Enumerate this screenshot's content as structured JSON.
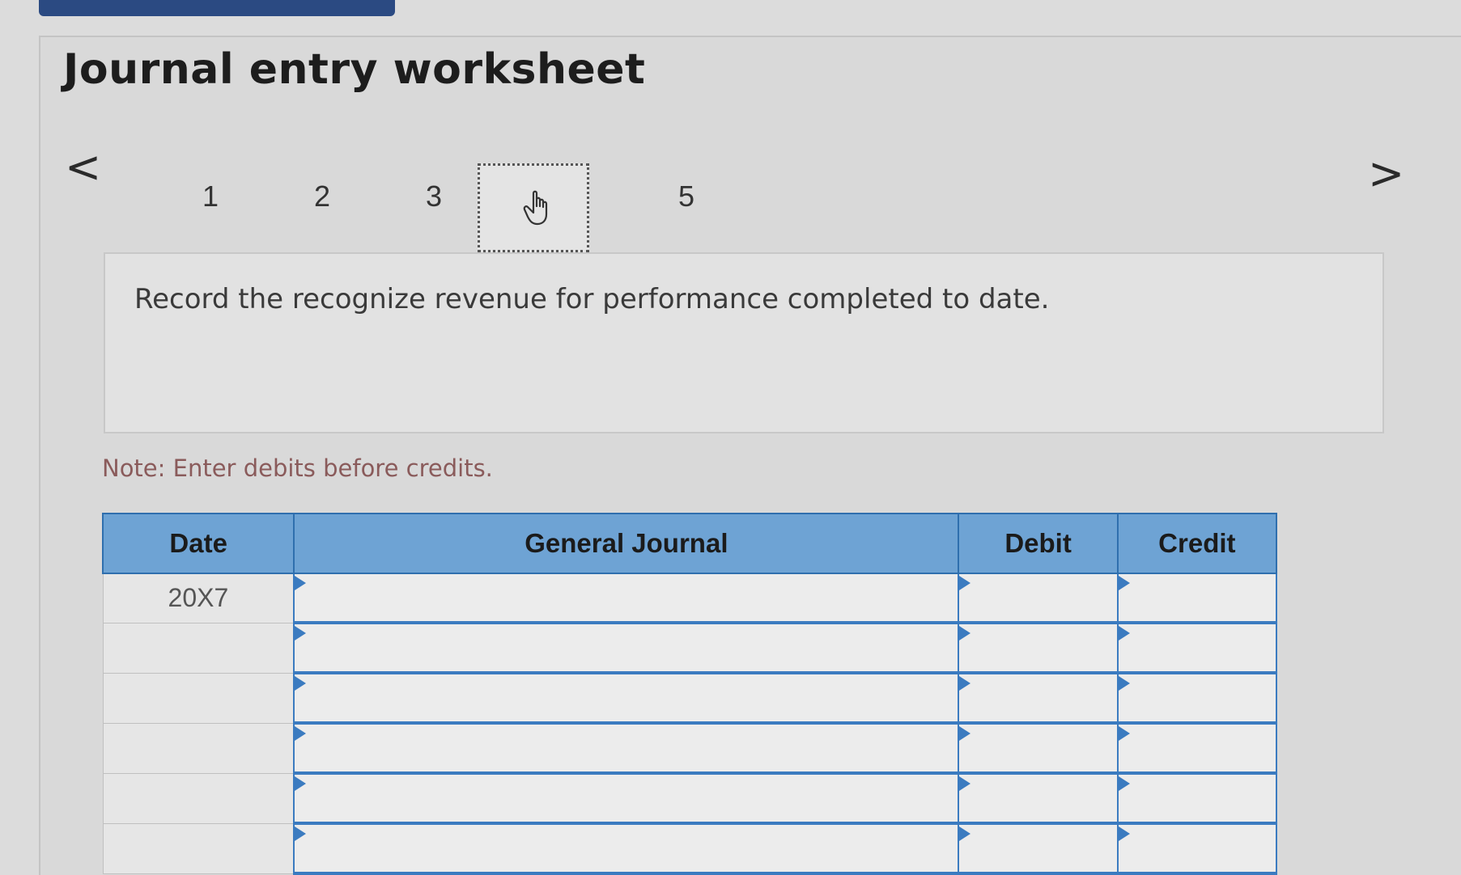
{
  "worksheet": {
    "title": "Journal entry worksheet"
  },
  "pager": {
    "prev_label": "<",
    "next_label": ">",
    "pages": [
      {
        "label": "1"
      },
      {
        "label": "2"
      },
      {
        "label": "3"
      },
      {
        "label": "",
        "current": true,
        "icon": "hand-pointer-icon"
      },
      {
        "label": "5"
      }
    ]
  },
  "instruction": {
    "text": "Record the recognize revenue for performance completed to date."
  },
  "note": {
    "text": "Note: Enter debits before credits."
  },
  "table": {
    "headers": {
      "date": "Date",
      "general_journal": "General Journal",
      "debit": "Debit",
      "credit": "Credit"
    },
    "rows": [
      {
        "date": "20X7"
      },
      {
        "date": ""
      },
      {
        "date": ""
      },
      {
        "date": ""
      },
      {
        "date": ""
      },
      {
        "date": ""
      }
    ]
  },
  "colors": {
    "header_blue": "#6ea3d4",
    "border_blue": "#3b7bc0",
    "top_tab": "#2b4a82",
    "note_text": "#8a5b5b"
  }
}
